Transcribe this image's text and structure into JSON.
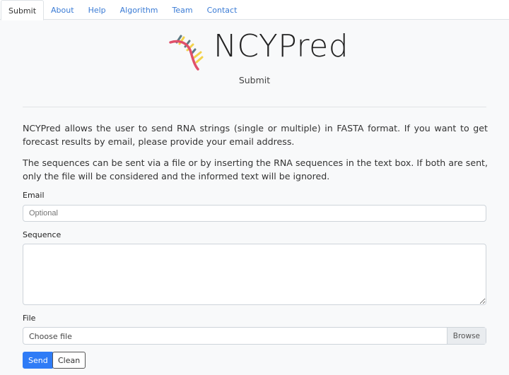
{
  "tabs": [
    {
      "label": "Submit",
      "active": true
    },
    {
      "label": "About"
    },
    {
      "label": "Help"
    },
    {
      "label": "Algorithm"
    },
    {
      "label": "Team"
    },
    {
      "label": "Contact"
    }
  ],
  "header": {
    "title": "NCYPred",
    "subtitle": "Submit",
    "logo_icon": "rna-helix-icon",
    "logo_colors": [
      "#e0506a",
      "#f2d24b",
      "#5e7b85"
    ]
  },
  "intro": [
    "NCYPred allows the user to send RNA strings (single or multiple) in FASTA format. If you want to get forecast results by email, please provide your email address.",
    "The sequences can be sent via a file or by inserting the RNA sequences in the text box. If both are sent, only the file will be considered and the informed text will be ignored."
  ],
  "form": {
    "email_label": "Email",
    "email_placeholder": "Optional",
    "email_value": "",
    "sequence_label": "Sequence",
    "sequence_value": "",
    "file_label": "File",
    "file_placeholder": "Choose file",
    "browse_label": "Browse",
    "send_label": "Send",
    "clean_label": "Clean"
  },
  "colors": {
    "primary": "#2f7cf6",
    "link": "#3a7bd5"
  }
}
